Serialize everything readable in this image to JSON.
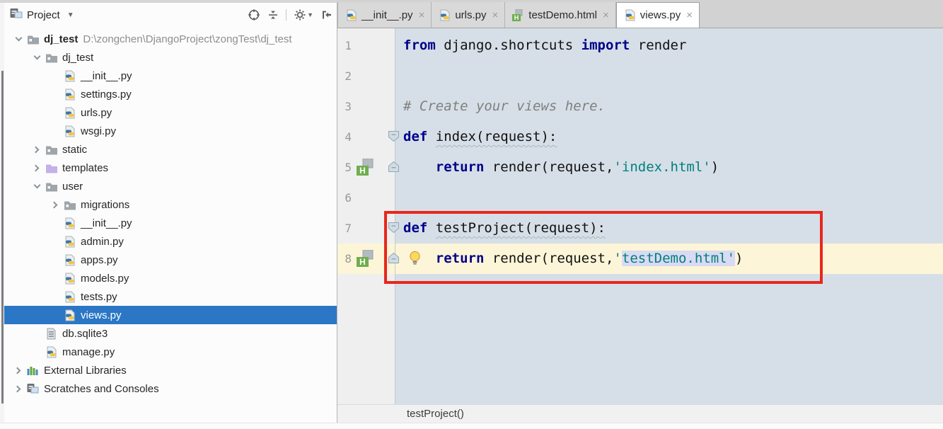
{
  "project_panel": {
    "title": "Project",
    "toolbar": {
      "locate": "Select Opened File",
      "collapse": "Collapse All",
      "settings": "Settings",
      "hide": "Hide"
    },
    "tree": [
      {
        "label": "dj_test",
        "path": "D:\\zongchen\\DjangoProject\\zongTest\\dj_test",
        "icon": "folder",
        "level": 0,
        "chevron": "expanded",
        "bold": true
      },
      {
        "label": "dj_test",
        "icon": "folder",
        "level": 1,
        "chevron": "expanded"
      },
      {
        "label": "__init__.py",
        "icon": "python",
        "level": 2
      },
      {
        "label": "settings.py",
        "icon": "python",
        "level": 2
      },
      {
        "label": "urls.py",
        "icon": "python",
        "level": 2
      },
      {
        "label": "wsgi.py",
        "icon": "python",
        "level": 2
      },
      {
        "label": "static",
        "icon": "folder",
        "level": 1,
        "chevron": "collapsed"
      },
      {
        "label": "templates",
        "icon": "folder-templates",
        "level": 1,
        "chevron": "collapsed"
      },
      {
        "label": "user",
        "icon": "folder",
        "level": 1,
        "chevron": "expanded"
      },
      {
        "label": "migrations",
        "icon": "folder",
        "level": 2,
        "chevron": "collapsed"
      },
      {
        "label": "__init__.py",
        "icon": "python",
        "level": 2
      },
      {
        "label": "admin.py",
        "icon": "python",
        "level": 2
      },
      {
        "label": "apps.py",
        "icon": "python",
        "level": 2
      },
      {
        "label": "models.py",
        "icon": "python",
        "level": 2
      },
      {
        "label": "tests.py",
        "icon": "python",
        "level": 2
      },
      {
        "label": "views.py",
        "icon": "python",
        "level": 2,
        "selected": true
      },
      {
        "label": "db.sqlite3",
        "icon": "file",
        "level": 1
      },
      {
        "label": "manage.py",
        "icon": "python",
        "level": 1
      },
      {
        "label": "External Libraries",
        "icon": "libs",
        "level": 0,
        "chevron": "collapsed"
      },
      {
        "label": "Scratches and Consoles",
        "icon": "scratches",
        "level": 0,
        "chevron": "collapsed"
      }
    ]
  },
  "editor": {
    "tabs": [
      {
        "label": "__init__.py",
        "icon": "python"
      },
      {
        "label": "urls.py",
        "icon": "python"
      },
      {
        "label": "testDemo.html",
        "icon": "html"
      },
      {
        "label": "views.py",
        "icon": "python",
        "active": true
      }
    ],
    "close_glyph": "×",
    "lines": [
      {
        "num": "1",
        "segments": [
          {
            "c": "kw",
            "t": "from"
          },
          {
            "c": "plain",
            "t": " django.shortcuts "
          },
          {
            "c": "kw",
            "t": "import"
          },
          {
            "c": "plain",
            "t": " render"
          }
        ]
      },
      {
        "num": "2",
        "segments": []
      },
      {
        "num": "3",
        "segments": [
          {
            "c": "com",
            "t": "# Create your views here."
          }
        ]
      },
      {
        "num": "4",
        "fold": "top",
        "segments": [
          {
            "c": "kw",
            "t": "def"
          },
          {
            "c": "plain",
            "t": " "
          },
          {
            "c": "plain wavy",
            "t": "index(request):"
          }
        ]
      },
      {
        "num": "5",
        "fold": "bottom",
        "gutter_icon": "html",
        "segments": [
          {
            "c": "plain",
            "t": "    "
          },
          {
            "c": "kw",
            "t": "return"
          },
          {
            "c": "plain",
            "t": " render(request,"
          },
          {
            "c": "str",
            "t": "'index.html'"
          },
          {
            "c": "plain",
            "t": ")"
          }
        ]
      },
      {
        "num": "6",
        "segments": []
      },
      {
        "num": "7",
        "fold": "top",
        "segments": [
          {
            "c": "kw",
            "t": "def"
          },
          {
            "c": "plain",
            "t": " "
          },
          {
            "c": "plain wavy",
            "t": "testProject(request):"
          }
        ]
      },
      {
        "num": "8",
        "current": true,
        "fold": "bottom",
        "gutter_icon": "html",
        "bulb": true,
        "segments": [
          {
            "c": "plain",
            "t": "    "
          },
          {
            "c": "kw",
            "t": "return"
          },
          {
            "c": "plain",
            "t": " render(request,"
          },
          {
            "c": "str",
            "t": "'"
          },
          {
            "c": "str sel",
            "t": "testDemo.html'"
          },
          {
            "c": "plain",
            "t": ")"
          }
        ]
      }
    ],
    "breadcrumb": "testProject()"
  },
  "colors": {
    "tree_selection": "#2b77c5",
    "editor_bg": "#d6dfe7",
    "current_line": "#fcf5d7",
    "selection": "#d9daf3",
    "keyword": "#00008b",
    "string": "#00807e",
    "comment": "#808080",
    "annotation_red": "#e8271d",
    "template_green": "#6fae4e",
    "templates_folder_purple": "#c3b1e8"
  }
}
